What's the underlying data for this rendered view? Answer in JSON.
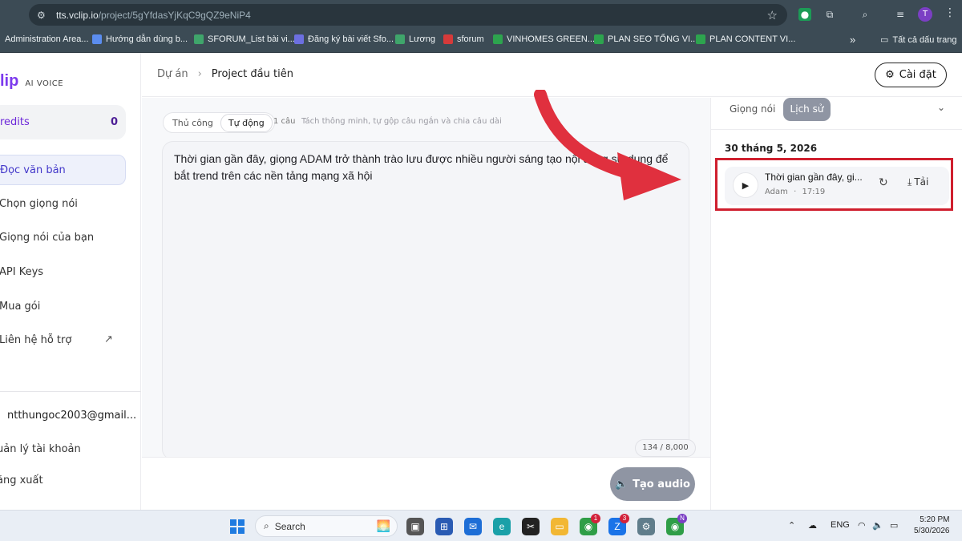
{
  "browser": {
    "url_host": "tts.vclip.io",
    "url_path": "/project/5gYfdasYjKqC9gQZ9eNiP4",
    "bookmarks": [
      {
        "label": "Administration Area..."
      },
      {
        "label": "Hướng dẫn dùng b..."
      },
      {
        "label": "SFORUM_List bài vi..."
      },
      {
        "label": "Đăng ký bài viết Sfo..."
      },
      {
        "label": "Lương"
      },
      {
        "label": "sforum"
      },
      {
        "label": "VINHOMES GREEN..."
      },
      {
        "label": "PLAN SEO TỔNG VI..."
      },
      {
        "label": "PLAN CONTENT VI..."
      }
    ],
    "more": "»",
    "folder_label": "Tất cả dấu trang",
    "profile_initial": "T"
  },
  "sidebar": {
    "logo_text": "lip",
    "logo_sub": "AI VOICE",
    "credits_label": "redits",
    "credits_value": "0",
    "items": [
      {
        "label": "Đọc văn bản"
      },
      {
        "label": "Chọn giọng nói"
      },
      {
        "label": "Giọng nói của bạn"
      },
      {
        "label": "API Keys"
      },
      {
        "label": "Mua gói"
      },
      {
        "label": "Liên hệ hỗ trợ"
      }
    ],
    "email": "ntthungoc2003@gmail...",
    "account_items": [
      {
        "label": "uản lý tài khoản"
      },
      {
        "label": "ăng xuất"
      }
    ]
  },
  "header": {
    "breadcrumb_root": "Dự án",
    "breadcrumb_current": "Project đầu tiên",
    "settings_label": "Cài đặt"
  },
  "editor": {
    "mode_manual": "Thủ công",
    "mode_auto": "Tự động",
    "sentence_count": "1 câu",
    "hint": "Tách thông minh, tự gộp câu ngắn và chia câu dài",
    "text": "Thời gian gần đây, giọng ADAM trở thành trào lưu được nhiều người sáng tạo nội dung sử dụng để bắt trend trên các nền tảng mạng xã hội",
    "counter": "134 / 8,000",
    "create_label": "Tạo audio"
  },
  "history": {
    "tab_voices": "Giọng nói",
    "tab_history": "Lịch sử",
    "date": "30 tháng 5, 2026",
    "item_title": "Thời gian gần đây, gi...",
    "item_voice": "Adam",
    "item_dot": "·",
    "item_time": "17:19",
    "download_label": "Tải"
  },
  "taskbar": {
    "search_label": "Search",
    "badges": [
      "1",
      "3",
      "N"
    ],
    "language": "ENG",
    "time": "5:20 PM",
    "date": "5/30/2026"
  },
  "colors": {
    "accent_purple": "#7c3aed",
    "highlight_red": "#cf1f2e",
    "arrow_red": "#e0303e",
    "button_gray": "#8f95a3"
  }
}
